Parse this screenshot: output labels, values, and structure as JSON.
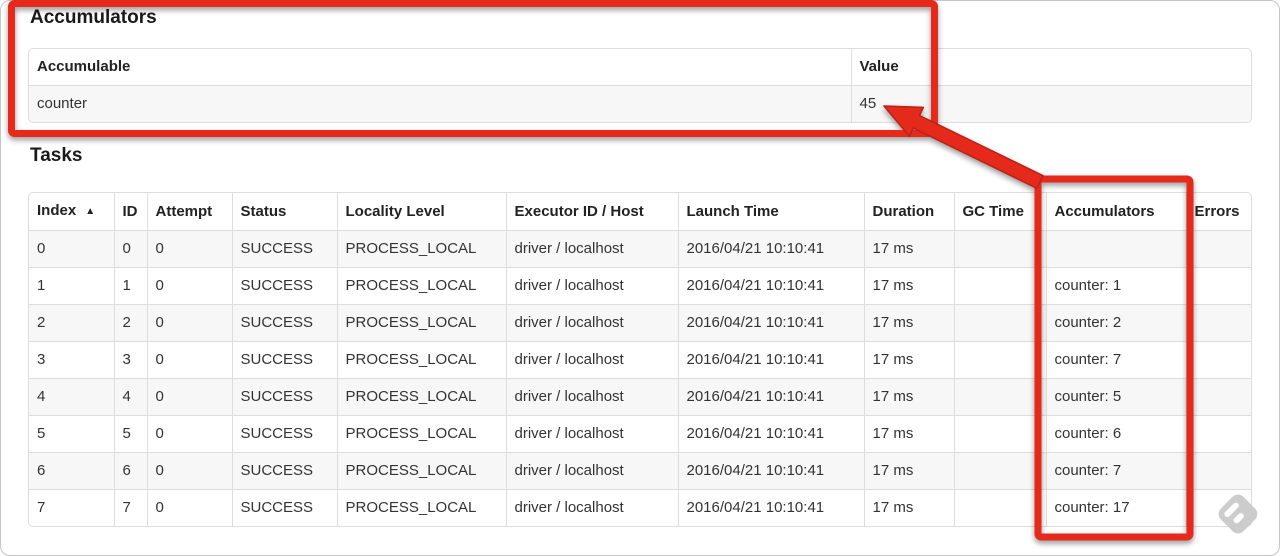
{
  "accumulators_section": {
    "title": "Accumulators",
    "table": {
      "headers": [
        "Accumulable",
        "Value"
      ],
      "rows": [
        [
          "counter",
          "45"
        ]
      ]
    }
  },
  "tasks_section": {
    "title": "Tasks",
    "table": {
      "headers": [
        "Index",
        "ID",
        "Attempt",
        "Status",
        "Locality Level",
        "Executor ID / Host",
        "Launch Time",
        "Duration",
        "GC Time",
        "Accumulators",
        "Errors"
      ],
      "sort": {
        "column": "Index",
        "icon": "▲"
      },
      "rows": [
        [
          "0",
          "0",
          "0",
          "SUCCESS",
          "PROCESS_LOCAL",
          "driver / localhost",
          "2016/04/21 10:10:41",
          "17 ms",
          "",
          "",
          ""
        ],
        [
          "1",
          "1",
          "0",
          "SUCCESS",
          "PROCESS_LOCAL",
          "driver / localhost",
          "2016/04/21 10:10:41",
          "17 ms",
          "",
          "counter: 1",
          ""
        ],
        [
          "2",
          "2",
          "0",
          "SUCCESS",
          "PROCESS_LOCAL",
          "driver / localhost",
          "2016/04/21 10:10:41",
          "17 ms",
          "",
          "counter: 2",
          ""
        ],
        [
          "3",
          "3",
          "0",
          "SUCCESS",
          "PROCESS_LOCAL",
          "driver / localhost",
          "2016/04/21 10:10:41",
          "17 ms",
          "",
          "counter: 7",
          ""
        ],
        [
          "4",
          "4",
          "0",
          "SUCCESS",
          "PROCESS_LOCAL",
          "driver / localhost",
          "2016/04/21 10:10:41",
          "17 ms",
          "",
          "counter: 5",
          ""
        ],
        [
          "5",
          "5",
          "0",
          "SUCCESS",
          "PROCESS_LOCAL",
          "driver / localhost",
          "2016/04/21 10:10:41",
          "17 ms",
          "",
          "counter: 6",
          ""
        ],
        [
          "6",
          "6",
          "0",
          "SUCCESS",
          "PROCESS_LOCAL",
          "driver / localhost",
          "2016/04/21 10:10:41",
          "17 ms",
          "",
          "counter: 7",
          ""
        ],
        [
          "7",
          "7",
          "0",
          "SUCCESS",
          "PROCESS_LOCAL",
          "driver / localhost",
          "2016/04/21 10:10:41",
          "17 ms",
          "",
          "counter: 17",
          ""
        ]
      ]
    }
  },
  "annotations": {
    "highlight_color": "#e52b1e",
    "box1_purpose": "highlights accumulators summary table",
    "box2_purpose": "highlights Accumulators column",
    "arrow_purpose": "points from Accumulators column to total value 45"
  },
  "watermark": {
    "color": "#cacaca"
  }
}
